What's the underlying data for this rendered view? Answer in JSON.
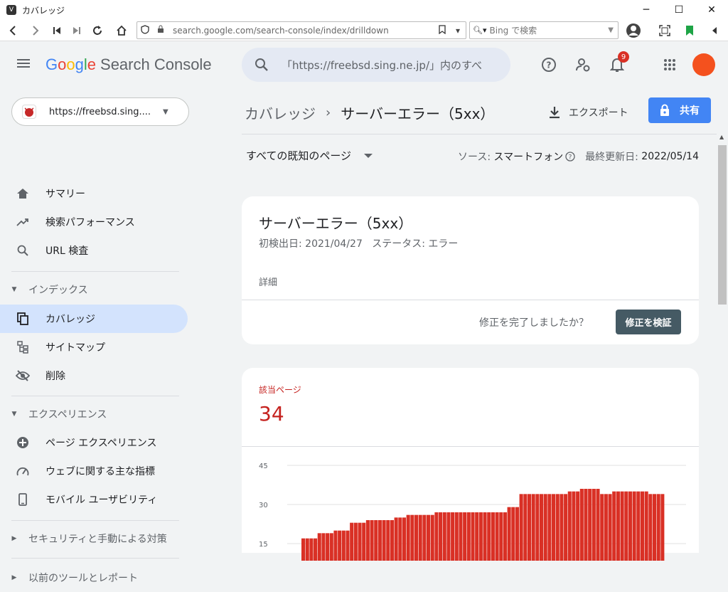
{
  "window": {
    "title": "カバレッジ",
    "minimize": "─",
    "maximize": "☐",
    "close": "✕"
  },
  "browser": {
    "url": "search.google.com/search-console/index/drilldown",
    "search_placeholder": "Bing で検索"
  },
  "header": {
    "logo_google": [
      "G",
      "o",
      "o",
      "g",
      "l",
      "e"
    ],
    "logo_product": "Search Console",
    "search_value": "「https://freebsd.sing.ne.jp/」内のすべ",
    "notification_count": "9"
  },
  "property": {
    "label": "https://freebsd.sing...."
  },
  "sidebar": {
    "items": [
      {
        "label": "サマリー",
        "icon": "home-icon"
      },
      {
        "label": "検索パフォーマンス",
        "icon": "trending-icon"
      },
      {
        "label": "URL 検査",
        "icon": "search-icon"
      }
    ],
    "section_index": "インデックス",
    "index_items": [
      {
        "label": "カバレッジ",
        "icon": "file-copy-icon",
        "active": true
      },
      {
        "label": "サイトマップ",
        "icon": "sitemap-icon"
      },
      {
        "label": "削除",
        "icon": "visibility-off-icon"
      }
    ],
    "section_experience": "エクスペリエンス",
    "experience_items": [
      {
        "label": "ページ エクスペリエンス",
        "icon": "plus-circle-icon"
      },
      {
        "label": "ウェブに関する主な指標",
        "icon": "speed-icon"
      },
      {
        "label": "モバイル ユーザビリティ",
        "icon": "phone-icon"
      }
    ],
    "section_security": "セキュリティと手動による対策",
    "section_legacy": "以前のツールとレポート"
  },
  "main": {
    "breadcrumb_parent": "カバレッジ",
    "breadcrumb_sep": "›",
    "breadcrumb_current": "サーバーエラー（5xx）",
    "export_label": "エクスポート",
    "share_label": "共有",
    "filter_label": "すべての既知のページ",
    "source_label": "ソース:",
    "source_value": "スマートフォン",
    "updated_label": "最終更新日:",
    "updated_value": "2022/05/14"
  },
  "issue_card": {
    "title": "サーバーエラー（5xx）",
    "first_detected": "初検出日: 2021/04/27",
    "status": "ステータス: エラー",
    "details": "詳細",
    "question": "修正を完了しましたか？",
    "validate_button": "修正を検証"
  },
  "pages_card": {
    "label": "該当ページ",
    "value": "34"
  },
  "chart_data": {
    "type": "bar",
    "y_ticks": [
      "45",
      "30",
      "15"
    ],
    "ylim": [
      0,
      45
    ],
    "values": [
      17,
      17,
      17,
      17,
      19,
      19,
      19,
      19,
      20,
      20,
      20,
      20,
      23,
      23,
      23,
      23,
      24,
      24,
      24,
      24,
      24,
      24,
      24,
      25,
      25,
      25,
      26,
      26,
      26,
      26,
      26,
      26,
      26,
      27,
      27,
      27,
      27,
      27,
      27,
      27,
      27,
      27,
      27,
      27,
      27,
      27,
      27,
      27,
      27,
      27,
      27,
      29,
      29,
      29,
      34,
      34,
      34,
      34,
      34,
      34,
      34,
      34,
      34,
      34,
      34,
      34,
      35,
      35,
      35,
      36,
      36,
      36,
      36,
      36,
      34,
      34,
      34,
      35,
      35,
      35,
      35,
      35,
      35,
      35,
      35,
      35,
      34,
      34,
      34,
      34
    ],
    "bar_color": "#d93025",
    "grid": true
  }
}
